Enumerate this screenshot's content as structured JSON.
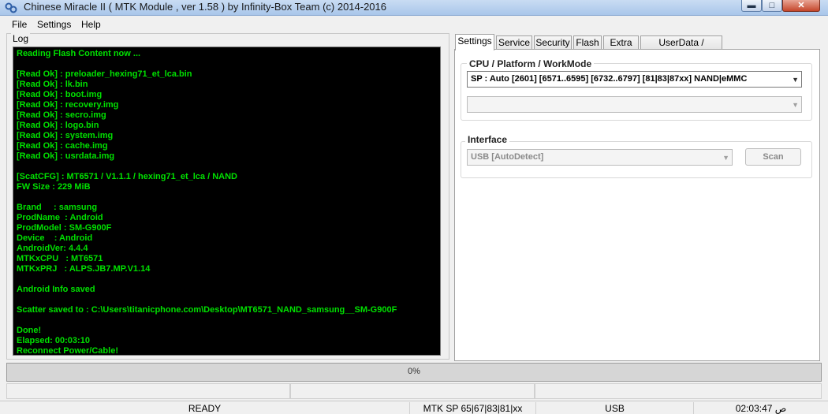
{
  "window": {
    "title": "Chinese Miracle II ( MTK Module , ver 1.58 ) by Infinity-Box Team (c) 2014-2016",
    "controls": [
      "minimize",
      "maximize",
      "close"
    ]
  },
  "menu": {
    "file": "File",
    "settings": "Settings",
    "help": "Help"
  },
  "log": {
    "caption": "Log",
    "text": "Reading Flash Content now ...\n\n[Read Ok] : preloader_hexing71_et_lca.bin\n[Read Ok] : lk.bin\n[Read Ok] : boot.img\n[Read Ok] : recovery.img\n[Read Ok] : secro.img\n[Read Ok] : logo.bin\n[Read Ok] : system.img\n[Read Ok] : cache.img\n[Read Ok] : usrdata.img\n\n[ScatCFG] : MT6571 / V1.1.1 / hexing71_et_lca / NAND\nFW Size : 229 MiB\n\nBrand     : samsung\nProdName  : Android\nProdModel : SM-G900F\nDevice    : Android\nAndroidVer: 4.4.4\nMTKxCPU   : MT6571\nMTKxPRJ   : ALPS.JB7.MP.V1.14\n\nAndroid Info saved\n\nScatter saved to : C:\\Users\\titanicphone.com\\Desktop\\MT6571_NAND_samsung__SM-G900F\n\nDone!\nElapsed: 00:03:10\nReconnect Power/Cable!"
  },
  "tabs": [
    {
      "label": "Settings",
      "active": true
    },
    {
      "label": "Service",
      "active": false
    },
    {
      "label": "Security",
      "active": false
    },
    {
      "label": "Flash",
      "active": false
    },
    {
      "label": "Extra",
      "active": false
    },
    {
      "label": "UserData / Forensic",
      "active": false
    }
  ],
  "settings": {
    "cpu_caption": "CPU / Platform / WorkMode",
    "cpu_selected": "SP : Auto [2601] [6571..6595] [6732..6797] [81|83|87xx]  NAND|eMMC",
    "workmode_selected": "",
    "interface_caption": "Interface",
    "interface_selected": "USB [AutoDetect]",
    "scan_label": "Scan"
  },
  "progress": {
    "text": "0%",
    "value": 0
  },
  "status": {
    "state": "READY",
    "platform": "MTK SP 65|67|83|81|xx",
    "connection": "USB",
    "time": "02:03:47 ص"
  },
  "colors": {
    "log_background": "#000000",
    "log_text": "#00e000",
    "titlebar": "#b9d1ee"
  }
}
